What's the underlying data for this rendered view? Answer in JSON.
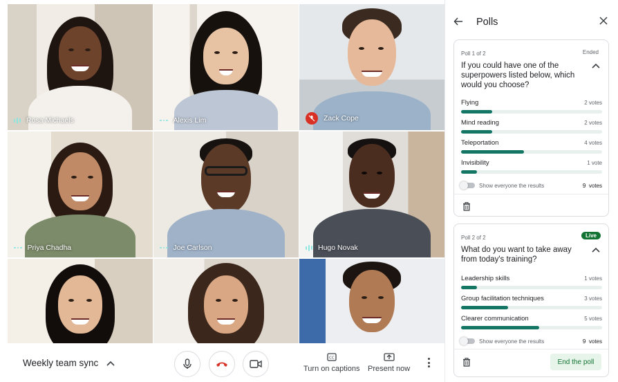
{
  "participants": [
    {
      "name": "Rosa Michaels",
      "indicator": "speaking"
    },
    {
      "name": "Alexis Lim",
      "indicator": "idle"
    },
    {
      "name": "Zack Cope",
      "indicator": "muted"
    },
    {
      "name": "Priya Chadha",
      "indicator": "idle"
    },
    {
      "name": "Joe Carlson",
      "indicator": "idle"
    },
    {
      "name": "Hugo Novak",
      "indicator": "speaking"
    },
    {
      "name": "",
      "indicator": "none"
    },
    {
      "name": "",
      "indicator": "none"
    },
    {
      "name": "",
      "indicator": "none"
    }
  ],
  "bottom_bar": {
    "meeting_title": "Weekly team sync",
    "captions_label": "Turn on captions",
    "present_label": "Present now",
    "icons": [
      "chevron-up-icon",
      "microphone-icon",
      "end-call-icon",
      "camera-icon",
      "captions-icon",
      "present-icon",
      "more-options-icon"
    ]
  },
  "panel": {
    "title": "Polls",
    "polls": [
      {
        "meta": "Poll 1 of 2",
        "status": "Ended",
        "question": "If you could have one of the superpowers listed below, which would you choose?",
        "options": [
          {
            "label": "Flying",
            "votes_text": "2 votes",
            "votes": 2
          },
          {
            "label": "Mind reading",
            "votes_text": "2 votes",
            "votes": 2
          },
          {
            "label": "Teleportation",
            "votes_text": "4 votes",
            "votes": 4
          },
          {
            "label": "Invisibility",
            "votes_text": "1 vote",
            "votes": 1
          }
        ],
        "toggle_label": "Show everyone the results",
        "total_number": "9",
        "total_unit": "votes"
      },
      {
        "meta": "Poll 2 of 2",
        "status": "Live",
        "question": "What do you want to take away from today's training?",
        "options": [
          {
            "label": "Leadership skills",
            "votes_text": "1 votes",
            "votes": 1
          },
          {
            "label": "Group facilitation techniques",
            "votes_text": "3 votes",
            "votes": 3
          },
          {
            "label": "Clearer communication",
            "votes_text": "5 votes",
            "votes": 5
          }
        ],
        "toggle_label": "Show everyone the results",
        "total_number": "9",
        "total_unit": "votes",
        "end_button": "End the poll"
      }
    ]
  },
  "colors": {
    "accent": "#137564",
    "live_badge": "#137333",
    "end_call": "#d93025",
    "speaking_indicator": "#8ce6e0"
  }
}
